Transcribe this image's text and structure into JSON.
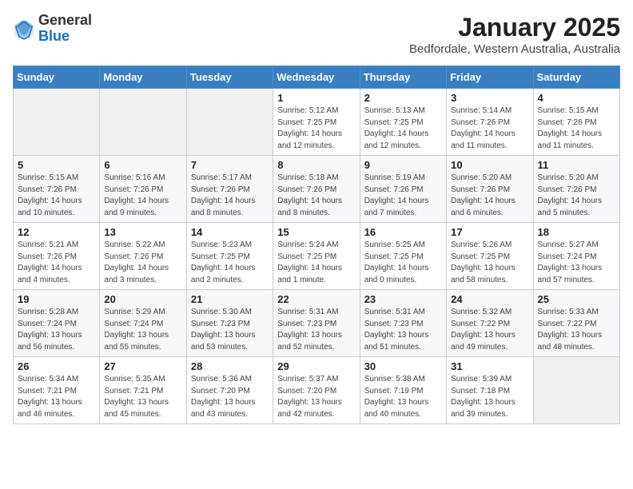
{
  "logo": {
    "general": "General",
    "blue": "Blue"
  },
  "header": {
    "title": "January 2025",
    "subtitle": "Bedfordale, Western Australia, Australia"
  },
  "weekdays": [
    "Sunday",
    "Monday",
    "Tuesday",
    "Wednesday",
    "Thursday",
    "Friday",
    "Saturday"
  ],
  "weeks": [
    [
      {
        "day": "",
        "sunrise": "",
        "sunset": "",
        "daylight": ""
      },
      {
        "day": "",
        "sunrise": "",
        "sunset": "",
        "daylight": ""
      },
      {
        "day": "",
        "sunrise": "",
        "sunset": "",
        "daylight": ""
      },
      {
        "day": "1",
        "sunrise": "Sunrise: 5:12 AM",
        "sunset": "Sunset: 7:25 PM",
        "daylight": "Daylight: 14 hours and 12 minutes."
      },
      {
        "day": "2",
        "sunrise": "Sunrise: 5:13 AM",
        "sunset": "Sunset: 7:25 PM",
        "daylight": "Daylight: 14 hours and 12 minutes."
      },
      {
        "day": "3",
        "sunrise": "Sunrise: 5:14 AM",
        "sunset": "Sunset: 7:26 PM",
        "daylight": "Daylight: 14 hours and 11 minutes."
      },
      {
        "day": "4",
        "sunrise": "Sunrise: 5:15 AM",
        "sunset": "Sunset: 7:26 PM",
        "daylight": "Daylight: 14 hours and 11 minutes."
      }
    ],
    [
      {
        "day": "5",
        "sunrise": "Sunrise: 5:15 AM",
        "sunset": "Sunset: 7:26 PM",
        "daylight": "Daylight: 14 hours and 10 minutes."
      },
      {
        "day": "6",
        "sunrise": "Sunrise: 5:16 AM",
        "sunset": "Sunset: 7:26 PM",
        "daylight": "Daylight: 14 hours and 9 minutes."
      },
      {
        "day": "7",
        "sunrise": "Sunrise: 5:17 AM",
        "sunset": "Sunset: 7:26 PM",
        "daylight": "Daylight: 14 hours and 8 minutes."
      },
      {
        "day": "8",
        "sunrise": "Sunrise: 5:18 AM",
        "sunset": "Sunset: 7:26 PM",
        "daylight": "Daylight: 14 hours and 8 minutes."
      },
      {
        "day": "9",
        "sunrise": "Sunrise: 5:19 AM",
        "sunset": "Sunset: 7:26 PM",
        "daylight": "Daylight: 14 hours and 7 minutes."
      },
      {
        "day": "10",
        "sunrise": "Sunrise: 5:20 AM",
        "sunset": "Sunset: 7:26 PM",
        "daylight": "Daylight: 14 hours and 6 minutes."
      },
      {
        "day": "11",
        "sunrise": "Sunrise: 5:20 AM",
        "sunset": "Sunset: 7:26 PM",
        "daylight": "Daylight: 14 hours and 5 minutes."
      }
    ],
    [
      {
        "day": "12",
        "sunrise": "Sunrise: 5:21 AM",
        "sunset": "Sunset: 7:26 PM",
        "daylight": "Daylight: 14 hours and 4 minutes."
      },
      {
        "day": "13",
        "sunrise": "Sunrise: 5:22 AM",
        "sunset": "Sunset: 7:26 PM",
        "daylight": "Daylight: 14 hours and 3 minutes."
      },
      {
        "day": "14",
        "sunrise": "Sunrise: 5:23 AM",
        "sunset": "Sunset: 7:25 PM",
        "daylight": "Daylight: 14 hours and 2 minutes."
      },
      {
        "day": "15",
        "sunrise": "Sunrise: 5:24 AM",
        "sunset": "Sunset: 7:25 PM",
        "daylight": "Daylight: 14 hours and 1 minute."
      },
      {
        "day": "16",
        "sunrise": "Sunrise: 5:25 AM",
        "sunset": "Sunset: 7:25 PM",
        "daylight": "Daylight: 14 hours and 0 minutes."
      },
      {
        "day": "17",
        "sunrise": "Sunrise: 5:26 AM",
        "sunset": "Sunset: 7:25 PM",
        "daylight": "Daylight: 13 hours and 58 minutes."
      },
      {
        "day": "18",
        "sunrise": "Sunrise: 5:27 AM",
        "sunset": "Sunset: 7:24 PM",
        "daylight": "Daylight: 13 hours and 57 minutes."
      }
    ],
    [
      {
        "day": "19",
        "sunrise": "Sunrise: 5:28 AM",
        "sunset": "Sunset: 7:24 PM",
        "daylight": "Daylight: 13 hours and 56 minutes."
      },
      {
        "day": "20",
        "sunrise": "Sunrise: 5:29 AM",
        "sunset": "Sunset: 7:24 PM",
        "daylight": "Daylight: 13 hours and 55 minutes."
      },
      {
        "day": "21",
        "sunrise": "Sunrise: 5:30 AM",
        "sunset": "Sunset: 7:23 PM",
        "daylight": "Daylight: 13 hours and 53 minutes."
      },
      {
        "day": "22",
        "sunrise": "Sunrise: 5:31 AM",
        "sunset": "Sunset: 7:23 PM",
        "daylight": "Daylight: 13 hours and 52 minutes."
      },
      {
        "day": "23",
        "sunrise": "Sunrise: 5:31 AM",
        "sunset": "Sunset: 7:23 PM",
        "daylight": "Daylight: 13 hours and 51 minutes."
      },
      {
        "day": "24",
        "sunrise": "Sunrise: 5:32 AM",
        "sunset": "Sunset: 7:22 PM",
        "daylight": "Daylight: 13 hours and 49 minutes."
      },
      {
        "day": "25",
        "sunrise": "Sunrise: 5:33 AM",
        "sunset": "Sunset: 7:22 PM",
        "daylight": "Daylight: 13 hours and 48 minutes."
      }
    ],
    [
      {
        "day": "26",
        "sunrise": "Sunrise: 5:34 AM",
        "sunset": "Sunset: 7:21 PM",
        "daylight": "Daylight: 13 hours and 46 minutes."
      },
      {
        "day": "27",
        "sunrise": "Sunrise: 5:35 AM",
        "sunset": "Sunset: 7:21 PM",
        "daylight": "Daylight: 13 hours and 45 minutes."
      },
      {
        "day": "28",
        "sunrise": "Sunrise: 5:36 AM",
        "sunset": "Sunset: 7:20 PM",
        "daylight": "Daylight: 13 hours and 43 minutes."
      },
      {
        "day": "29",
        "sunrise": "Sunrise: 5:37 AM",
        "sunset": "Sunset: 7:20 PM",
        "daylight": "Daylight: 13 hours and 42 minutes."
      },
      {
        "day": "30",
        "sunrise": "Sunrise: 5:38 AM",
        "sunset": "Sunset: 7:19 PM",
        "daylight": "Daylight: 13 hours and 40 minutes."
      },
      {
        "day": "31",
        "sunrise": "Sunrise: 5:39 AM",
        "sunset": "Sunset: 7:18 PM",
        "daylight": "Daylight: 13 hours and 39 minutes."
      },
      {
        "day": "",
        "sunrise": "",
        "sunset": "",
        "daylight": ""
      }
    ]
  ]
}
